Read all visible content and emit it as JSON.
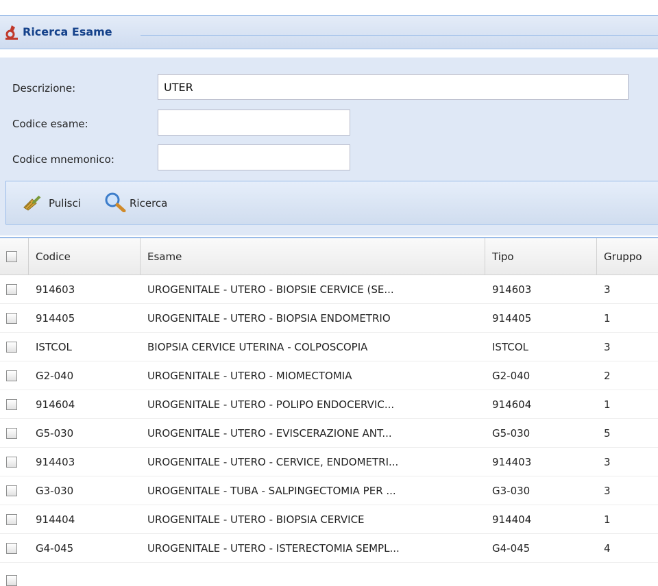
{
  "panel": {
    "title": "Ricerca Esame"
  },
  "form": {
    "descrizione_label": "Descrizione:",
    "descrizione_value": "UTER",
    "codice_esame_label": "Codice esame:",
    "codice_esame_value": "",
    "codice_mnemonico_label": "Codice mnemonico:",
    "codice_mnemonico_value": ""
  },
  "toolbar": {
    "pulisci_label": "Pulisci",
    "ricerca_label": "Ricerca"
  },
  "grid": {
    "columns": [
      "Codice",
      "Esame",
      "Tipo",
      "Gruppo"
    ],
    "rows": [
      {
        "codice": "914603",
        "esame": "UROGENITALE - UTERO - BIOPSIE CERVICE (SE...",
        "tipo": "914603",
        "gruppo": "3"
      },
      {
        "codice": "914405",
        "esame": "UROGENITALE - UTERO - BIOPSIA ENDOMETRIO",
        "tipo": "914405",
        "gruppo": "1"
      },
      {
        "codice": "ISTCOL",
        "esame": "BIOPSIA CERVICE UTERINA - COLPOSCOPIA",
        "tipo": "ISTCOL",
        "gruppo": "3"
      },
      {
        "codice": "G2-040",
        "esame": "UROGENITALE - UTERO - MIOMECTOMIA",
        "tipo": "G2-040",
        "gruppo": "2"
      },
      {
        "codice": "914604",
        "esame": "UROGENITALE - UTERO - POLIPO ENDOCERVIC...",
        "tipo": "914604",
        "gruppo": "1"
      },
      {
        "codice": "G5-030",
        "esame": "UROGENITALE - UTERO - EVISCERAZIONE ANT...",
        "tipo": "G5-030",
        "gruppo": "5"
      },
      {
        "codice": "914403",
        "esame": "UROGENITALE - UTERO - CERVICE, ENDOMETRI...",
        "tipo": "914403",
        "gruppo": "3"
      },
      {
        "codice": "G3-030",
        "esame": "UROGENITALE - TUBA - SALPINGECTOMIA PER ...",
        "tipo": "G3-030",
        "gruppo": "3"
      },
      {
        "codice": "914404",
        "esame": "UROGENITALE - UTERO - BIOPSIA CERVICE",
        "tipo": "914404",
        "gruppo": "1"
      },
      {
        "codice": "G4-045",
        "esame": "UROGENITALE - UTERO - ISTERECTOMIA SEMPL...",
        "tipo": "G4-045",
        "gruppo": "4"
      }
    ]
  },
  "icons": {
    "panel_icon": "microscope-icon",
    "pulisci_icon": "broom-icon",
    "ricerca_icon": "magnifier-icon"
  },
  "colors": {
    "header_text": "#15428b",
    "border_blue": "#99bbe8",
    "form_bg": "#dfe8f6"
  }
}
